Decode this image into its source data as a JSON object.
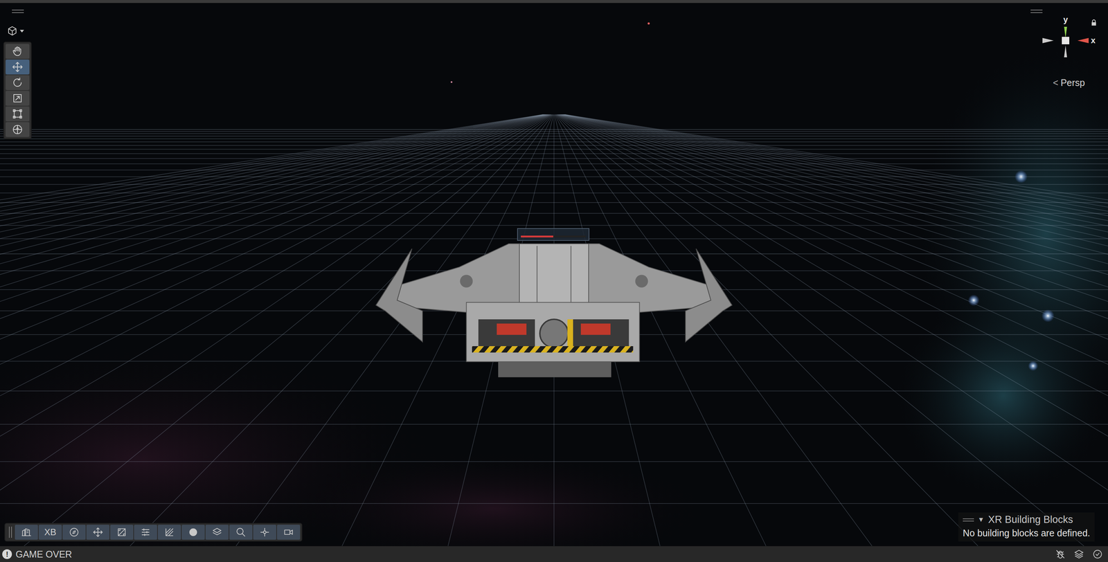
{
  "scene_view": {
    "camera": {
      "arrow": "<",
      "label": "Persp"
    },
    "gizmo": {
      "axes": [
        {
          "label": "y"
        },
        {
          "label": "x"
        }
      ],
      "locked": true
    },
    "tools": [
      {
        "selected": false
      },
      {
        "selected": true
      },
      {
        "selected": false
      },
      {
        "selected": false
      },
      {
        "selected": false
      },
      {
        "selected": false
      }
    ],
    "health_bar": {
      "level": 0.5
    }
  },
  "bottom_toolbar": {
    "items": [
      {
        "kind": "icon",
        "selected": false
      },
      {
        "kind": "text",
        "label": "XB",
        "selected": false
      },
      {
        "kind": "icon",
        "selected": false
      },
      {
        "kind": "icon",
        "selected": false
      },
      {
        "kind": "icon",
        "selected": false
      },
      {
        "kind": "icon",
        "selected": false
      },
      {
        "kind": "icon",
        "selected": false
      },
      {
        "kind": "icon",
        "selected": false
      },
      {
        "kind": "icon",
        "selected": false
      },
      {
        "kind": "icon",
        "selected": false
      },
      {
        "kind": "icon",
        "selected": false
      },
      {
        "kind": "icon",
        "selected": false
      }
    ]
  },
  "overlay": {
    "title": "XR Building Blocks",
    "toggle": "▼",
    "expanded": true,
    "message": "No building blocks are defined."
  },
  "status_bar": {
    "icon": "!",
    "message": "GAME OVER"
  }
}
